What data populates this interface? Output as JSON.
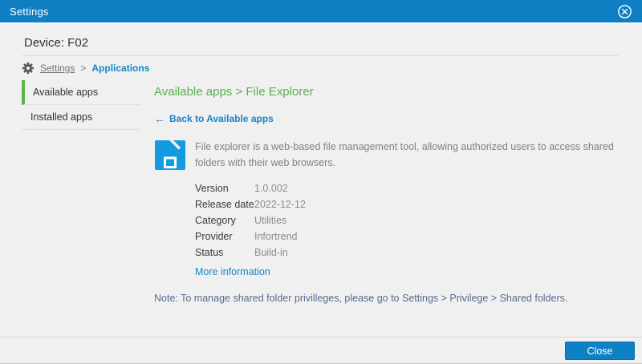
{
  "titlebar": {
    "title": "Settings"
  },
  "header": {
    "device_label": "Device: F02"
  },
  "breadcrumb": {
    "root": "Settings",
    "separator": ">",
    "current": "Applications"
  },
  "sidebar": {
    "items": [
      {
        "label": "Available apps",
        "active": true
      },
      {
        "label": "Installed apps",
        "active": false
      }
    ]
  },
  "main": {
    "heading": "Available apps > File Explorer",
    "back_link": {
      "arrow": "←",
      "label": "Back to Available apps"
    },
    "app": {
      "icon": "file-explorer-folder-icon",
      "description": "File explorer is a web-based file management tool, allowing authorized users to access shared folders with their web browsers.",
      "details": [
        {
          "label": "Version",
          "value": "1.0.002"
        },
        {
          "label": "Release date",
          "value": "2022-12-12"
        },
        {
          "label": "Category",
          "value": "Utilities"
        },
        {
          "label": "Provider",
          "value": "Infortrend"
        },
        {
          "label": "Status",
          "value": "Build-in"
        }
      ],
      "more_info_label": "More information"
    },
    "note": "Note: To manage shared folder privilleges, please go to Settings > Privilege > Shared folders."
  },
  "footer": {
    "close_label": "Close"
  },
  "colors": {
    "titlebar_blue": "#0f7ec2",
    "accent_blue": "#1586c8",
    "accent_green": "#56b14b",
    "sidebar_active_green": "#5cb44c",
    "app_icon_blue": "#149bdf",
    "note_text": "#5a6b8e"
  }
}
